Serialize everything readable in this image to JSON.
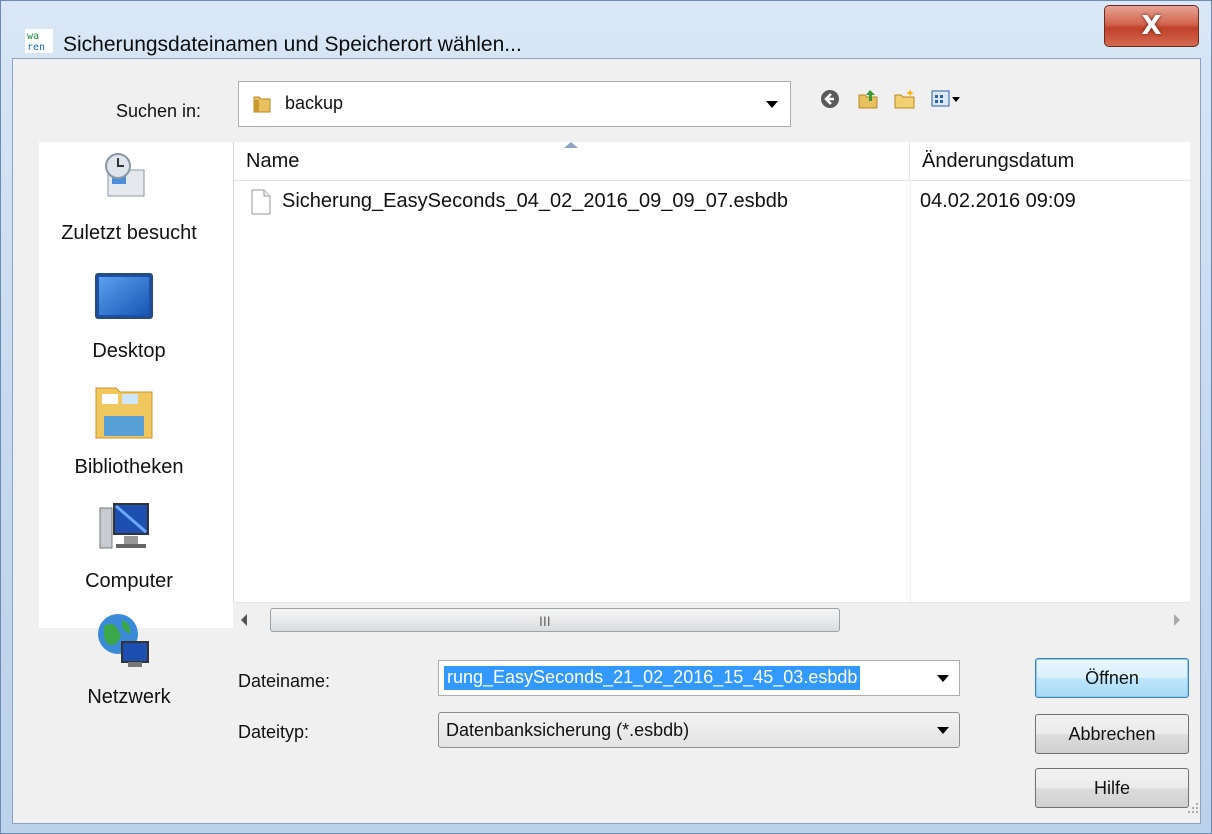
{
  "window": {
    "title": "Sicherungsdateinamen und Speicherort wählen...",
    "close_label": "X"
  },
  "lookin": {
    "label": "Suchen in:",
    "value": "backup"
  },
  "toolbar": {
    "icons": [
      "back-icon",
      "up-folder-icon",
      "new-folder-icon",
      "view-menu-icon"
    ]
  },
  "places": [
    {
      "label": "Zuletzt besucht",
      "icon": "recent-places-icon"
    },
    {
      "label": "Desktop",
      "icon": "desktop-icon"
    },
    {
      "label": "Bibliotheken",
      "icon": "libraries-icon"
    },
    {
      "label": "Computer",
      "icon": "computer-icon"
    },
    {
      "label": "Netzwerk",
      "icon": "network-icon"
    }
  ],
  "filelist": {
    "columns": [
      "Name",
      "Änderungsdatum"
    ],
    "rows": [
      {
        "name": "Sicherung_EasySeconds_04_02_2016_09_09_07.esbdb",
        "date": "04.02.2016 09:09"
      }
    ],
    "scroll_grip": "III"
  },
  "form": {
    "filename_label": "Dateiname:",
    "filename_value": "rung_EasySeconds_21_02_2016_15_45_03.esbdb",
    "filetype_label": "Dateityp:",
    "filetype_value": "Datenbanksicherung (*.esbdb)"
  },
  "buttons": {
    "open": "Öffnen",
    "cancel": "Abbrechen",
    "help": "Hilfe"
  },
  "colors": {
    "selection": "#3399ff",
    "close_button": "#c0412a"
  }
}
